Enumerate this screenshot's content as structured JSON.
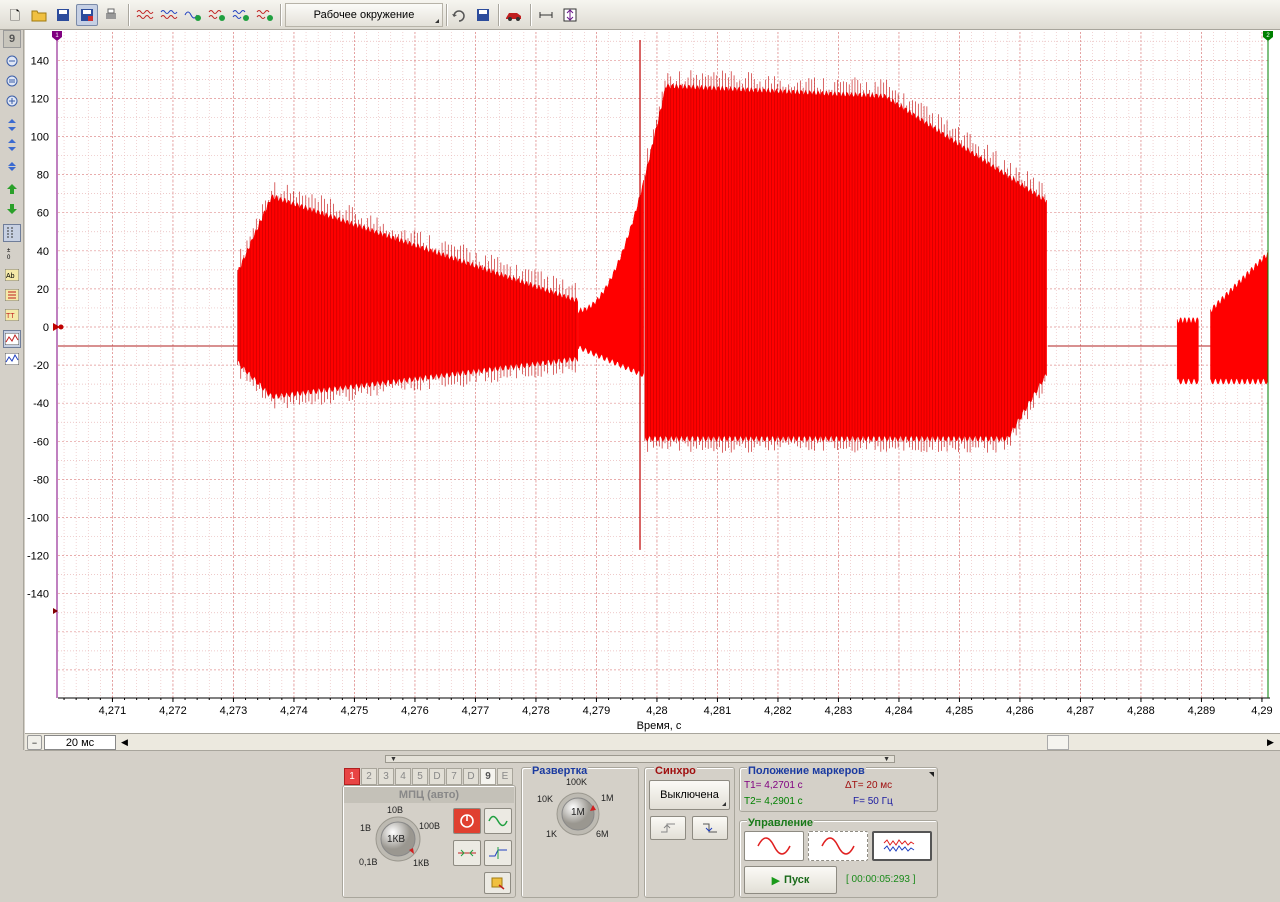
{
  "toolbar": {
    "workspace_label": "Рабочее окружение"
  },
  "left_toolbar": {
    "channel_badge": "9"
  },
  "plot": {
    "y_ticks": [
      "140",
      "120",
      "100",
      "80",
      "60",
      "40",
      "20",
      "0",
      "-20",
      "-40",
      "-60",
      "-80",
      "-100",
      "-120",
      "-140"
    ],
    "x_ticks": [
      "4,271",
      "4,272",
      "4,273",
      "4,274",
      "4,275",
      "4,276",
      "4,277",
      "4,278",
      "4,279",
      "4,28",
      "4,281",
      "4,282",
      "4,283",
      "4,284",
      "4,285",
      "4,286",
      "4,287",
      "4,288",
      "4,289",
      "4,29"
    ],
    "xlabel": "Время, с",
    "marker1": "1",
    "marker2": "2",
    "colors": {
      "signal": "#ff0000",
      "grid": "#e8b8b8",
      "grid_major": "#e09090",
      "marker1": "#800080",
      "marker2": "#008000"
    }
  },
  "hscroll": {
    "zoom_value": "20 мс"
  },
  "channel_panel": {
    "tabs": [
      "1",
      "2",
      "3",
      "4",
      "5",
      "D",
      "7",
      "D",
      "9",
      "E"
    ],
    "active_tab": "1",
    "mode_label": "МПЦ (авто)",
    "knob_labels": {
      "top": "10В",
      "left_top": "1В",
      "right_top": "100В",
      "left_bottom": "0,1В",
      "right_bottom": "1КВ",
      "center": "1КВ"
    }
  },
  "sweep_panel": {
    "title": "Развертка",
    "knob_labels": {
      "top": "100K",
      "left": "10K",
      "right": "1M",
      "left_bottom": "1K",
      "right_bottom": "6M",
      "center": "1M"
    }
  },
  "sync_panel": {
    "title": "Синхро",
    "mode": "Выключена"
  },
  "markers_panel": {
    "title": "Положение маркеров",
    "t1": "T1= 4,2701 с",
    "t2": "T2= 4,2901 с",
    "dt": "ΔT= 20 мс",
    "freq": "F= 50 Гц"
  },
  "control_panel": {
    "title": "Управление",
    "start_label": "Пуск",
    "timer": "[ 00:00:05:293 ]"
  }
}
